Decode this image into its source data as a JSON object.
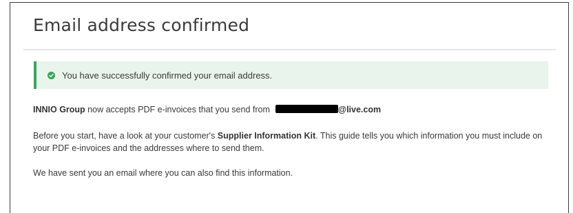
{
  "page": {
    "title": "Email address confirmed"
  },
  "alert": {
    "icon": "check-circle-icon",
    "color": "#3aa35a",
    "message": "You have successfully confirmed your email address."
  },
  "accept_paragraph": {
    "company": "INNIO Group",
    "text": " now accepts PDF e-invoices that you send from",
    "email_domain": "@live.com"
  },
  "kit_paragraph": {
    "before": "Before you start, have a look at your customer's ",
    "kit_name": "Supplier Information Kit",
    "after": ". This guide tells you which information you must include on your PDF e-invoices and the addresses where to send them."
  },
  "email_note": {
    "text": "We have sent you an email where you can also find this information."
  }
}
